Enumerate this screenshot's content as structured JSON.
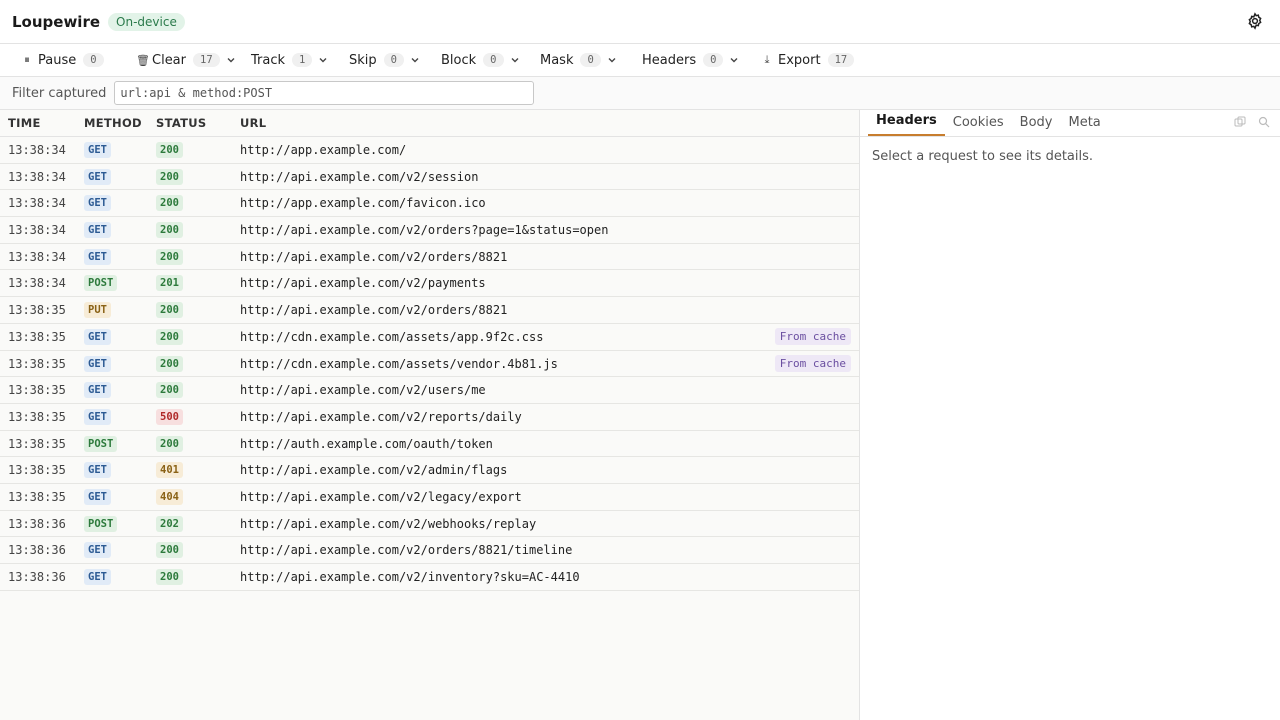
{
  "header": {
    "title": "Loupewire",
    "badge": "On-device",
    "settings_icon": "gear-icon"
  },
  "toolbar": [
    {
      "label": "Pause",
      "count": "0",
      "icon": "pause-icon",
      "glyph": "⏸",
      "chevron": false
    },
    {
      "label": "Clear",
      "count": "17",
      "icon": "trash-icon",
      "glyph": "🗑",
      "chevron": true
    },
    {
      "label": "Track",
      "count": "1",
      "icon": "",
      "glyph": "",
      "chevron": true
    },
    {
      "label": "Skip",
      "count": "0",
      "icon": "",
      "glyph": "",
      "chevron": true
    },
    {
      "label": "Block",
      "count": "0",
      "icon": "",
      "glyph": "",
      "chevron": true
    },
    {
      "label": "Mask",
      "count": "0",
      "icon": "",
      "glyph": "",
      "chevron": true
    },
    {
      "label": "Headers",
      "count": "0",
      "icon": "",
      "glyph": "",
      "chevron": true
    },
    {
      "label": "Export",
      "count": "17",
      "icon": "download-icon",
      "glyph": "⤓",
      "chevron": false
    }
  ],
  "filter": {
    "label": "Filter captured",
    "value": "",
    "placeholder": "url:api & method:POST"
  },
  "table": {
    "columns": [
      "TIME",
      "METHOD",
      "STATUS",
      "URL"
    ],
    "rows": [
      {
        "time": "13:38:34",
        "method": "GET",
        "status": "200",
        "url": "http://app.example.com/",
        "cache": ""
      },
      {
        "time": "13:38:34",
        "method": "GET",
        "status": "200",
        "url": "http://api.example.com/v2/session",
        "cache": ""
      },
      {
        "time": "13:38:34",
        "method": "GET",
        "status": "200",
        "url": "http://app.example.com/favicon.ico",
        "cache": ""
      },
      {
        "time": "13:38:34",
        "method": "GET",
        "status": "200",
        "url": "http://api.example.com/v2/orders?page=1&status=open",
        "cache": ""
      },
      {
        "time": "13:38:34",
        "method": "GET",
        "status": "200",
        "url": "http://api.example.com/v2/orders/8821",
        "cache": ""
      },
      {
        "time": "13:38:34",
        "method": "POST",
        "status": "201",
        "url": "http://api.example.com/v2/payments",
        "cache": ""
      },
      {
        "time": "13:38:35",
        "method": "PUT",
        "status": "200",
        "url": "http://api.example.com/v2/orders/8821",
        "cache": ""
      },
      {
        "time": "13:38:35",
        "method": "GET",
        "status": "200",
        "url": "http://cdn.example.com/assets/app.9f2c.css",
        "cache": "From cache"
      },
      {
        "time": "13:38:35",
        "method": "GET",
        "status": "200",
        "url": "http://cdn.example.com/assets/vendor.4b81.js",
        "cache": "From cache"
      },
      {
        "time": "13:38:35",
        "method": "GET",
        "status": "200",
        "url": "http://api.example.com/v2/users/me",
        "cache": ""
      },
      {
        "time": "13:38:35",
        "method": "GET",
        "status": "500",
        "url": "http://api.example.com/v2/reports/daily",
        "cache": ""
      },
      {
        "time": "13:38:35",
        "method": "POST",
        "status": "200",
        "url": "http://auth.example.com/oauth/token",
        "cache": ""
      },
      {
        "time": "13:38:35",
        "method": "GET",
        "status": "401",
        "url": "http://api.example.com/v2/admin/flags",
        "cache": ""
      },
      {
        "time": "13:38:35",
        "method": "GET",
        "status": "404",
        "url": "http://api.example.com/v2/legacy/export",
        "cache": ""
      },
      {
        "time": "13:38:36",
        "method": "POST",
        "status": "202",
        "url": "http://api.example.com/v2/webhooks/replay",
        "cache": ""
      },
      {
        "time": "13:38:36",
        "method": "GET",
        "status": "200",
        "url": "http://api.example.com/v2/orders/8821/timeline",
        "cache": ""
      },
      {
        "time": "13:38:36",
        "method": "GET",
        "status": "200",
        "url": "http://api.example.com/v2/inventory?sku=AC-4410",
        "cache": ""
      }
    ]
  },
  "details": {
    "tabs": [
      {
        "label": "Headers",
        "active": true
      },
      {
        "label": "Cookies",
        "active": false
      },
      {
        "label": "Body",
        "active": false
      },
      {
        "label": "Meta",
        "active": false
      }
    ],
    "empty_message": "Select a request to see its details.",
    "tool_icons": [
      "copy-icon",
      "search-icon"
    ]
  },
  "colors": {
    "accent": "#c77d2e",
    "badge_green": "#2b7a4b"
  }
}
